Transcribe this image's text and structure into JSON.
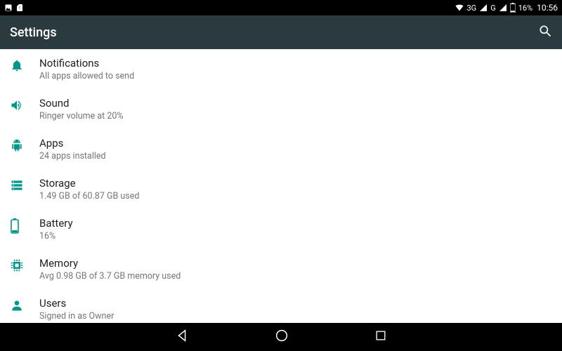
{
  "status": {
    "network_label_1": "3G",
    "network_label_2": "G",
    "battery_pct": "16%",
    "time": "10:56"
  },
  "appbar": {
    "title": "Settings"
  },
  "items": [
    {
      "title": "Notifications",
      "sub": "All apps allowed to send",
      "icon": "bell"
    },
    {
      "title": "Sound",
      "sub": "Ringer volume at 20%",
      "icon": "volume"
    },
    {
      "title": "Apps",
      "sub": "24 apps installed",
      "icon": "android"
    },
    {
      "title": "Storage",
      "sub": "1.49 GB of 60.87 GB used",
      "icon": "storage"
    },
    {
      "title": "Battery",
      "sub": "16%",
      "icon": "battery"
    },
    {
      "title": "Memory",
      "sub": "Avg 0.98 GB of 3.7 GB memory used",
      "icon": "memory"
    },
    {
      "title": "Users",
      "sub": "Signed in as Owner",
      "icon": "person"
    }
  ]
}
